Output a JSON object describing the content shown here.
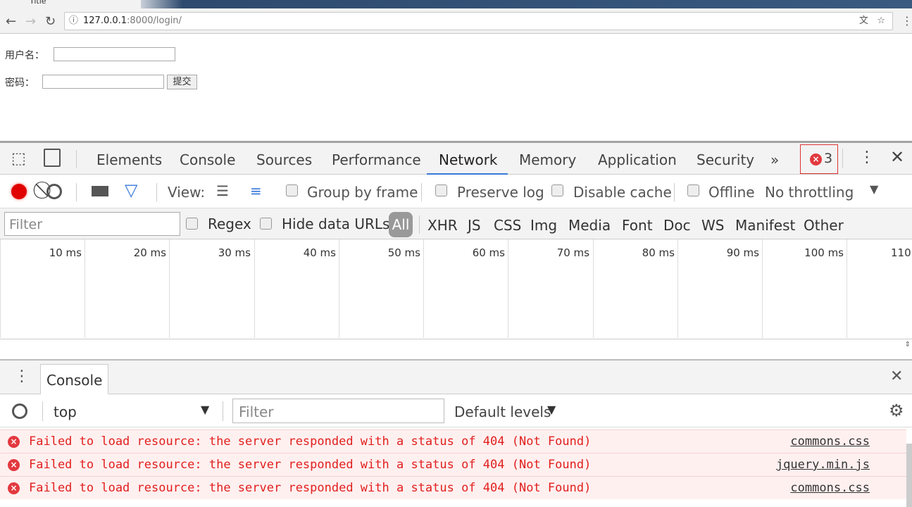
{
  "browser": {
    "tab_title": "Title",
    "url_host": "127.0.0.1",
    "url_rest": ":8000/login/"
  },
  "page": {
    "username_label": "用户名：",
    "password_label": "密码：",
    "submit_label": "提交"
  },
  "devtools": {
    "tabs": [
      "Elements",
      "Console",
      "Sources",
      "Performance",
      "Network",
      "Memory",
      "Application",
      "Security"
    ],
    "active_tab": "Network",
    "error_count": "3",
    "toolbar": {
      "view_label": "View:",
      "group_by_frame": "Group by frame",
      "preserve_log": "Preserve log",
      "disable_cache": "Disable cache",
      "offline": "Offline",
      "throttling": "No throttling"
    },
    "filter": {
      "placeholder": "Filter",
      "regex": "Regex",
      "hide_data_urls": "Hide data URLs",
      "types": [
        "All",
        "XHR",
        "JS",
        "CSS",
        "Img",
        "Media",
        "Font",
        "Doc",
        "WS",
        "Manifest",
        "Other"
      ]
    },
    "timeline_ticks": [
      "10 ms",
      "20 ms",
      "30 ms",
      "40 ms",
      "50 ms",
      "60 ms",
      "70 ms",
      "80 ms",
      "90 ms",
      "100 ms",
      "110"
    ],
    "drawer": {
      "tab": "Console",
      "context": "top",
      "filter_placeholder": "Filter",
      "levels": "Default levels"
    },
    "messages": [
      {
        "text": "Failed to load resource: the server responded with a status of 404 (Not Found)",
        "source": "commons.css"
      },
      {
        "text": "Failed to load resource: the server responded with a status of 404 (Not Found)",
        "source": "jquery.min.js"
      },
      {
        "text": "Failed to load resource: the server responded with a status of 404 (Not Found)",
        "source": "commons.css"
      }
    ],
    "colors": {
      "accent": "#3879d9",
      "error": "#e2393f",
      "record": "#e00000"
    }
  }
}
